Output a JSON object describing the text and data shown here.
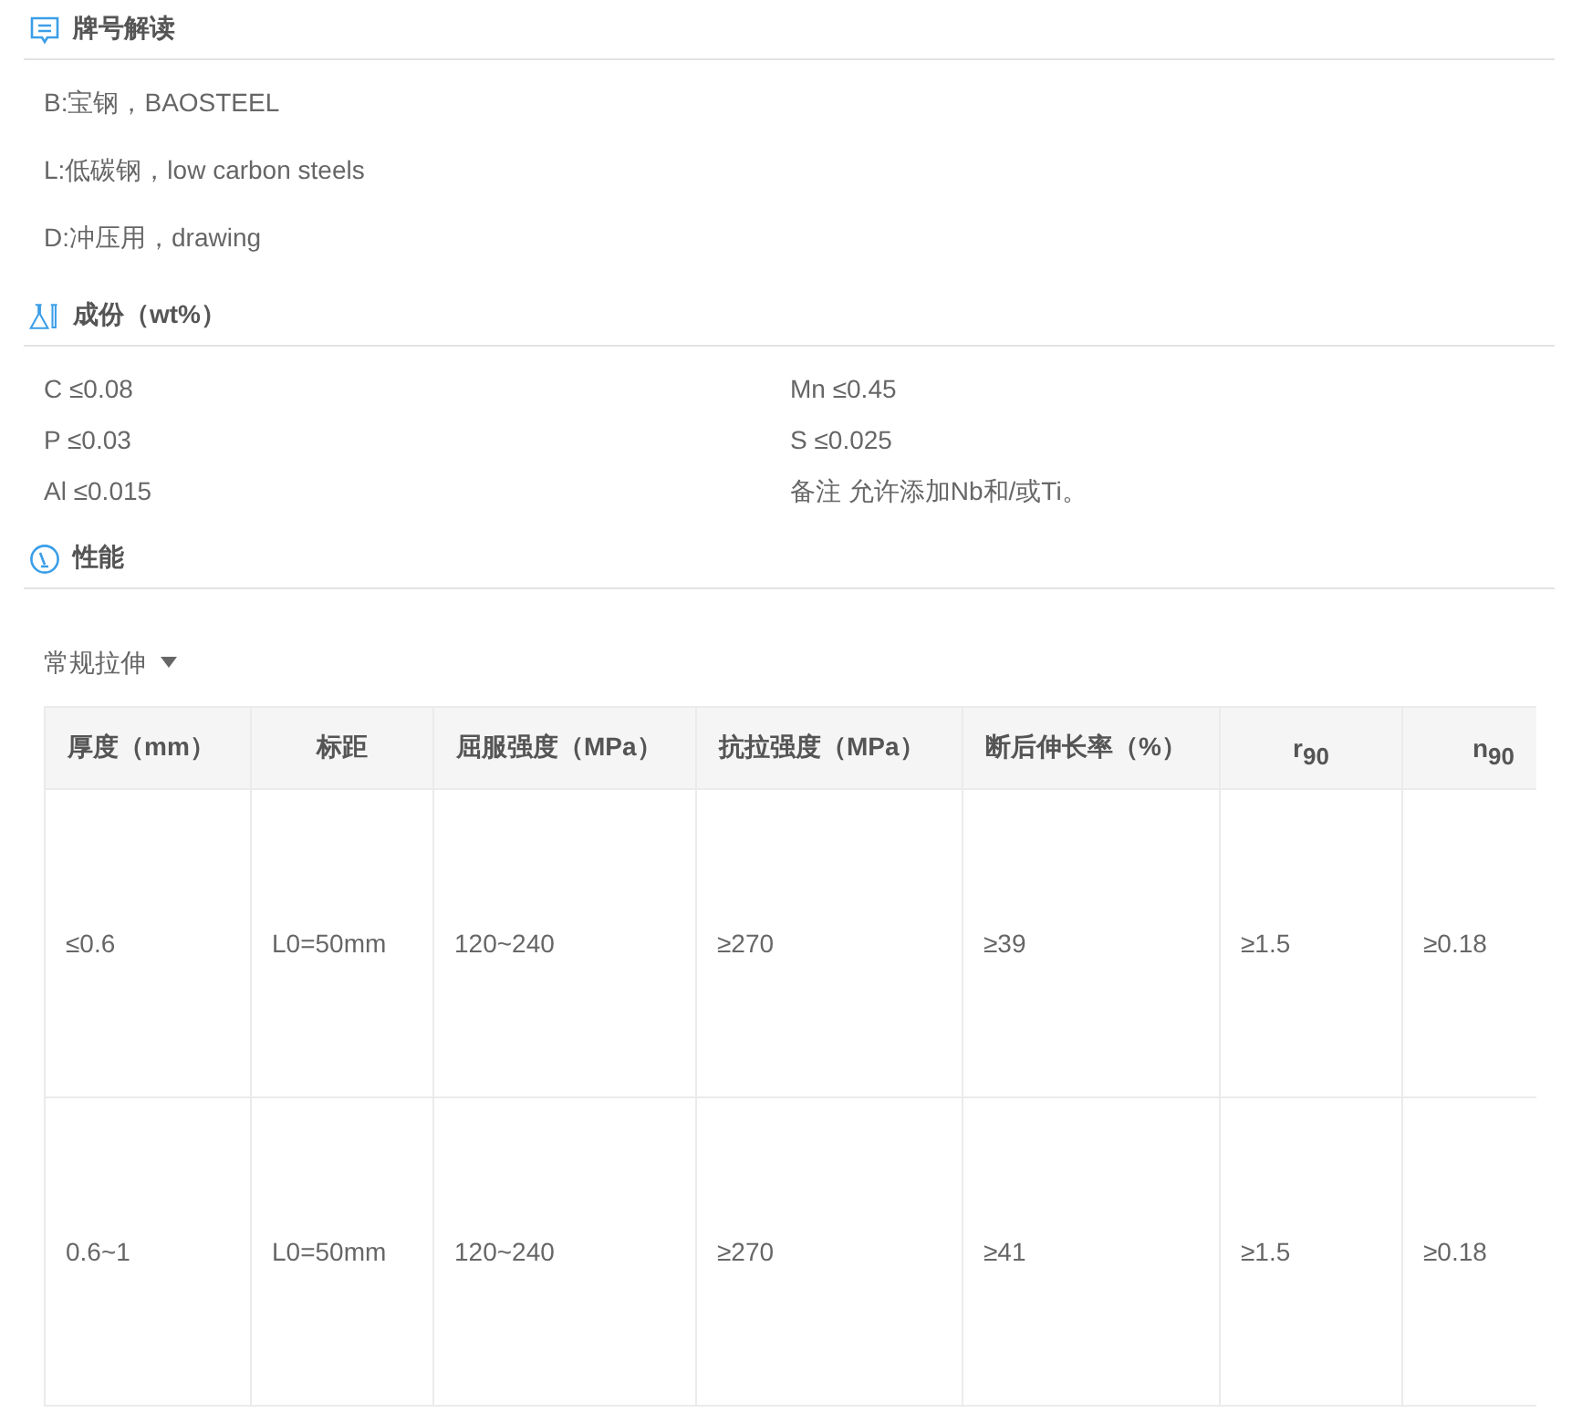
{
  "sections": [
    {
      "kind": "decode",
      "title": "牌号解读",
      "items": [
        "B:宝钢，BAOSTEEL",
        "L:低碳钢，low carbon steels",
        "D:冲压用，drawing"
      ]
    },
    {
      "kind": "composition",
      "title": "成份（wt%）",
      "items": [
        "C ≤0.08",
        "Mn ≤0.45",
        "P ≤0.03",
        "S ≤0.025",
        "Al ≤0.015",
        "备注 允许添加Nb和/或Ti。"
      ]
    },
    {
      "kind": "performance",
      "title": "性能",
      "dropdown": "常规拉伸",
      "table": {
        "columns": [
          "厚度（mm）",
          "标距",
          "屈服强度（MPa）",
          "抗拉强度（MPa）",
          "断后伸长率（%）",
          "r$_{90}$",
          "n$_{90}$"
        ],
        "rows": [
          [
            "≤0.6",
            "L0=50mm",
            "120~240",
            "≥270",
            "≥39",
            "≥1.5",
            "≥0.18"
          ],
          [
            "0.6~1",
            "L0=50mm",
            "120~240",
            "≥270",
            "≥41",
            "≥1.5",
            "≥0.18"
          ]
        ]
      }
    }
  ]
}
